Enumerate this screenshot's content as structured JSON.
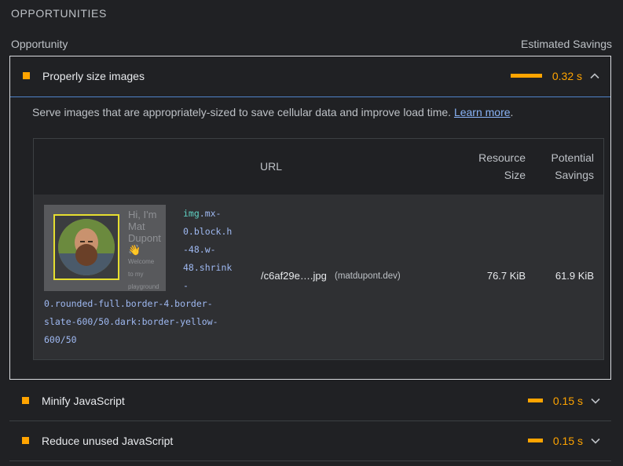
{
  "section": {
    "title": "OPPORTUNITIES"
  },
  "columns": {
    "opportunity": "Opportunity",
    "savings": "Estimated Savings"
  },
  "colors": {
    "warning": "#ffa400",
    "link": "#8ab4f8",
    "focus_border": "#4f83c8"
  },
  "audits": [
    {
      "title": "Properly size images",
      "savings": "0.32 s",
      "savings_fraction": 1.0,
      "expanded": true,
      "icon": "chevron-up-icon",
      "description": "Serve images that are appropriately-sized to save cellular data and improve load time.",
      "learn_more": "Learn more",
      "table": {
        "headers": {
          "url": "URL",
          "resource_size": [
            "Resource",
            "Size"
          ],
          "potential_savings": [
            "Potential",
            "Savings"
          ]
        },
        "rows": [
          {
            "thumbnail_text": {
              "line1": "Hi, I'm",
              "line2": "Mat",
              "line3": "Dupont",
              "emoji": "👋",
              "small1": "Welcome",
              "small2": "to my",
              "small3": "playground"
            },
            "selector_tag": "img",
            "selector_lines": [
              ".mx-",
              "0.block.h",
              "-48.w-",
              "48.shrink",
              "-",
              "0.rounded-full.border-4.border-",
              "slate-600/50.dark:border-yellow-",
              "600/50"
            ],
            "url": "/c6af29e….jpg",
            "host": "(matdupont.dev)",
            "resource_size": "76.7 KiB",
            "potential_savings": "61.9 KiB"
          }
        ]
      }
    },
    {
      "title": "Minify JavaScript",
      "savings": "0.15 s",
      "savings_fraction": 0.47,
      "expanded": false,
      "icon": "chevron-down-icon"
    },
    {
      "title": "Reduce unused JavaScript",
      "savings": "0.15 s",
      "savings_fraction": 0.47,
      "expanded": false,
      "icon": "chevron-down-icon"
    }
  ]
}
